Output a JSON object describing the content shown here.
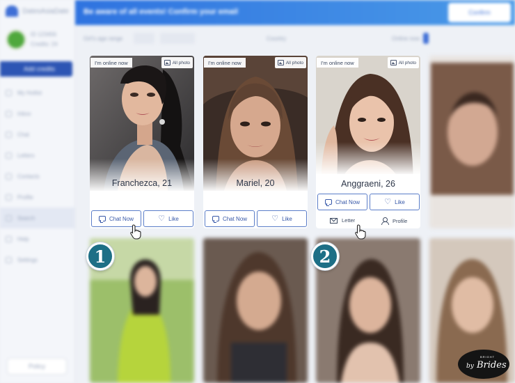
{
  "app": {
    "logo_text": "DatesAsiaDate",
    "add_credits": "Add credits",
    "profile_meta": [
      "ID 123456",
      "Credits: 24"
    ],
    "sidebar_items": [
      "My Hotlist",
      "Inbox",
      "Chat",
      "Letters",
      "Contacts",
      "Profile",
      "Search",
      "Help",
      "Settings"
    ],
    "sidebar_bottom": "Policy",
    "banner_text": "Be aware of all events! Confirm your email",
    "banner_button": "Confirm",
    "filter_labels": [
      "Girl's age range",
      "Country",
      "Online now"
    ]
  },
  "cards": [
    {
      "online": "I'm online now",
      "all_photo": "All photo",
      "name": "Franchezca, 21",
      "chat": "Chat Now",
      "like": "Like"
    },
    {
      "online": "I'm online now",
      "all_photo": "All photo",
      "name": "Mariel, 20",
      "chat": "Chat Now",
      "like": "Like"
    },
    {
      "online": "I'm online now",
      "all_photo": "All photo",
      "name": "Anggraeni, 26",
      "chat": "Chat Now",
      "like": "Like",
      "letter": "Letter",
      "profile": "Profile"
    }
  ],
  "badges": [
    "1",
    "2"
  ],
  "watermark": {
    "small": "BRIGHT",
    "by": "by",
    "brand": "Brides"
  },
  "icons": [
    "gallery-icon",
    "chat-icon",
    "heart-icon",
    "mail-icon",
    "user-icon",
    "hand-cursor-icon"
  ],
  "colors": {
    "accent": "#3758a8",
    "banner": "#2f73e0",
    "badge": "#1d6f86"
  }
}
